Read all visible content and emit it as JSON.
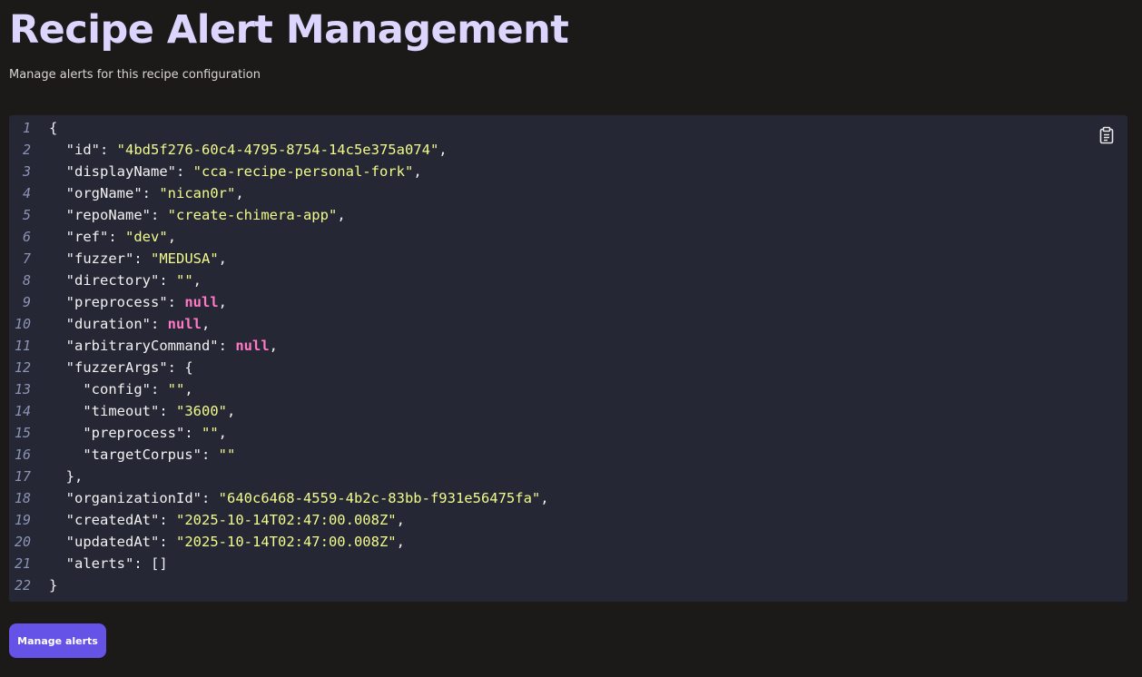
{
  "page": {
    "title": "Recipe Alert Management",
    "subtitle": "Manage alerts for this recipe configuration"
  },
  "code": {
    "lines": [
      [
        [
          "p",
          "{"
        ]
      ],
      [
        [
          "p",
          "  "
        ],
        [
          "k",
          "\"id\""
        ],
        [
          "p",
          ": "
        ],
        [
          "s",
          "\"4bd5f276-60c4-4795-8754-14c5e375a074\""
        ],
        [
          "p",
          ","
        ]
      ],
      [
        [
          "p",
          "  "
        ],
        [
          "k",
          "\"displayName\""
        ],
        [
          "p",
          ": "
        ],
        [
          "s",
          "\"cca-recipe-personal-fork\""
        ],
        [
          "p",
          ","
        ]
      ],
      [
        [
          "p",
          "  "
        ],
        [
          "k",
          "\"orgName\""
        ],
        [
          "p",
          ": "
        ],
        [
          "s",
          "\"nican0r\""
        ],
        [
          "p",
          ","
        ]
      ],
      [
        [
          "p",
          "  "
        ],
        [
          "k",
          "\"repoName\""
        ],
        [
          "p",
          ": "
        ],
        [
          "s",
          "\"create-chimera-app\""
        ],
        [
          "p",
          ","
        ]
      ],
      [
        [
          "p",
          "  "
        ],
        [
          "k",
          "\"ref\""
        ],
        [
          "p",
          ": "
        ],
        [
          "s",
          "\"dev\""
        ],
        [
          "p",
          ","
        ]
      ],
      [
        [
          "p",
          "  "
        ],
        [
          "k",
          "\"fuzzer\""
        ],
        [
          "p",
          ": "
        ],
        [
          "s",
          "\"MEDUSA\""
        ],
        [
          "p",
          ","
        ]
      ],
      [
        [
          "p",
          "  "
        ],
        [
          "k",
          "\"directory\""
        ],
        [
          "p",
          ": "
        ],
        [
          "s",
          "\"\""
        ],
        [
          "p",
          ","
        ]
      ],
      [
        [
          "p",
          "  "
        ],
        [
          "k",
          "\"preprocess\""
        ],
        [
          "p",
          ": "
        ],
        [
          "n",
          "null"
        ],
        [
          "p",
          ","
        ]
      ],
      [
        [
          "p",
          "  "
        ],
        [
          "k",
          "\"duration\""
        ],
        [
          "p",
          ": "
        ],
        [
          "n",
          "null"
        ],
        [
          "p",
          ","
        ]
      ],
      [
        [
          "p",
          "  "
        ],
        [
          "k",
          "\"arbitraryCommand\""
        ],
        [
          "p",
          ": "
        ],
        [
          "n",
          "null"
        ],
        [
          "p",
          ","
        ]
      ],
      [
        [
          "p",
          "  "
        ],
        [
          "k",
          "\"fuzzerArgs\""
        ],
        [
          "p",
          ": {"
        ]
      ],
      [
        [
          "p",
          "    "
        ],
        [
          "k",
          "\"config\""
        ],
        [
          "p",
          ": "
        ],
        [
          "s",
          "\"\""
        ],
        [
          "p",
          ","
        ]
      ],
      [
        [
          "p",
          "    "
        ],
        [
          "k",
          "\"timeout\""
        ],
        [
          "p",
          ": "
        ],
        [
          "s",
          "\"3600\""
        ],
        [
          "p",
          ","
        ]
      ],
      [
        [
          "p",
          "    "
        ],
        [
          "k",
          "\"preprocess\""
        ],
        [
          "p",
          ": "
        ],
        [
          "s",
          "\"\""
        ],
        [
          "p",
          ","
        ]
      ],
      [
        [
          "p",
          "    "
        ],
        [
          "k",
          "\"targetCorpus\""
        ],
        [
          "p",
          ": "
        ],
        [
          "s",
          "\"\""
        ]
      ],
      [
        [
          "p",
          "  },"
        ]
      ],
      [
        [
          "p",
          "  "
        ],
        [
          "k",
          "\"organizationId\""
        ],
        [
          "p",
          ": "
        ],
        [
          "s",
          "\"640c6468-4559-4b2c-83bb-f931e56475fa\""
        ],
        [
          "p",
          ","
        ]
      ],
      [
        [
          "p",
          "  "
        ],
        [
          "k",
          "\"createdAt\""
        ],
        [
          "p",
          ": "
        ],
        [
          "s",
          "\"2025-10-14T02:47:00.008Z\""
        ],
        [
          "p",
          ","
        ]
      ],
      [
        [
          "p",
          "  "
        ],
        [
          "k",
          "\"updatedAt\""
        ],
        [
          "p",
          ": "
        ],
        [
          "s",
          "\"2025-10-14T02:47:00.008Z\""
        ],
        [
          "p",
          ","
        ]
      ],
      [
        [
          "p",
          "  "
        ],
        [
          "k",
          "\"alerts\""
        ],
        [
          "p",
          ": []"
        ]
      ],
      [
        [
          "p",
          "}"
        ]
      ]
    ],
    "copy_icon": "clipboard-icon"
  },
  "actions": {
    "manage_alerts_label": "Manage alerts"
  },
  "colors": {
    "background": "#1c1a19",
    "title": "#dcd6ff",
    "panel": "#262734",
    "line_number": "#8b93b5",
    "string": "#f1fa8c",
    "null": "#ff79c6",
    "button": "#6552e6"
  }
}
